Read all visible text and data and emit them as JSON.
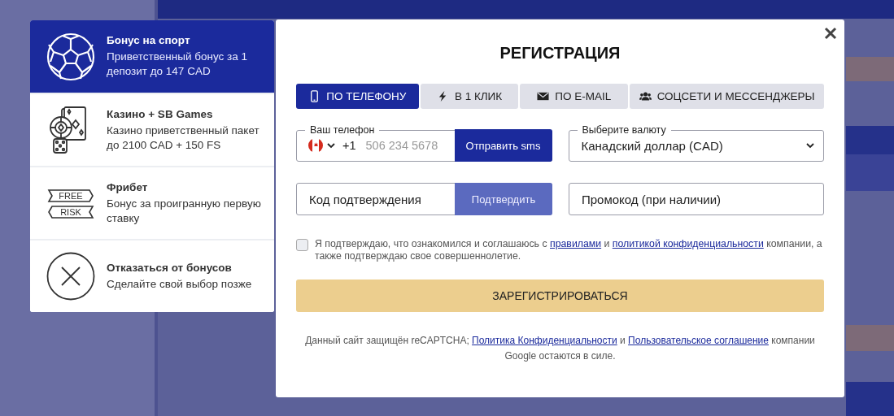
{
  "bonuses": [
    {
      "kind": "ball",
      "title": "Бонус на спорт",
      "description": "Приветственный бонус за 1 депозит до 147 CAD",
      "selected": true
    },
    {
      "kind": "casino",
      "title": "Казино + SB Games",
      "description": "Казино приветственный пакет до 2100 CAD + 150 FS",
      "selected": false
    },
    {
      "kind": "freebet",
      "tags": [
        "FREE",
        "RISK"
      ],
      "title": "Фрибет",
      "description": "Бонус за проигранную первую ставку",
      "selected": false
    },
    {
      "kind": "decline",
      "title": "Отказаться от бонусов",
      "description": "Сделайте свой выбор позже",
      "selected": false
    }
  ],
  "modal": {
    "title": "РЕГИСТРАЦИЯ",
    "tabs": [
      {
        "kind": "phone",
        "label": "ПО ТЕЛЕФОНУ",
        "selected": true
      },
      {
        "kind": "bolt",
        "label": "В 1 КЛИК",
        "selected": false
      },
      {
        "kind": "mail",
        "label": "ПО E-MAIL",
        "selected": false
      },
      {
        "kind": "users",
        "label": "СОЦСЕТИ И МЕССЕНДЖЕРЫ",
        "selected": false
      }
    ],
    "phone": {
      "label": "Ваш телефон",
      "code": "+1",
      "placeholder": "506 234 5678",
      "button": "Отправить sms"
    },
    "currency": {
      "label": "Выберите валюту",
      "value": "Канадский доллар (CAD)"
    },
    "confirmation": {
      "placeholder": "Код подтверждения",
      "button": "Подтвердить"
    },
    "promo": {
      "placeholder": "Промокод (при наличии)"
    },
    "consent": {
      "checked": false,
      "parts": [
        {
          "kind": "text",
          "text": "Я подтверждаю, что ознакомился и соглашаюсь с "
        },
        {
          "kind": "link",
          "text": "правилами"
        },
        {
          "kind": "text",
          "text": " и "
        },
        {
          "kind": "link",
          "text": "политикой конфиденциальности"
        },
        {
          "kind": "text",
          "text": " компании, а также подтверждаю свое совершеннолетие."
        }
      ]
    },
    "submit": "ЗАРЕГИСТРИРОВАТЬСЯ",
    "footer": [
      {
        "kind": "text",
        "text": "Данный сайт защищён reCAPTCHA; "
      },
      {
        "kind": "link",
        "text": "Политика Конфиденциальности"
      },
      {
        "kind": "text",
        "text": " и "
      },
      {
        "kind": "link",
        "text": "Пользовательское соглашение"
      },
      {
        "kind": "text",
        "text": " компании Google остаются в силе."
      }
    ]
  }
}
